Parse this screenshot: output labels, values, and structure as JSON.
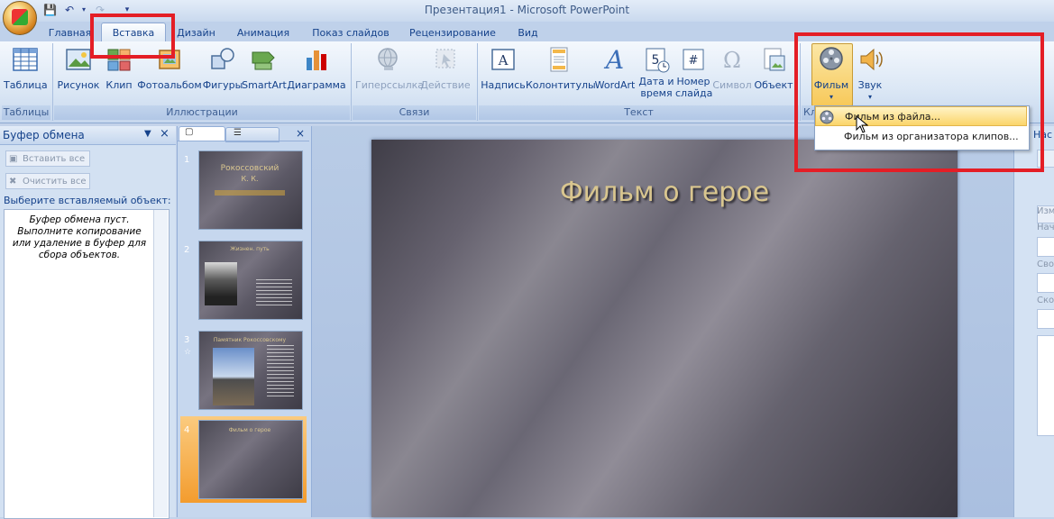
{
  "window": {
    "title": "Презентация1 - Microsoft PowerPoint"
  },
  "tabs": [
    {
      "label": "Главная"
    },
    {
      "label": "Вставка"
    },
    {
      "label": "Дизайн"
    },
    {
      "label": "Анимация"
    },
    {
      "label": "Показ слайдов"
    },
    {
      "label": "Рецензирование"
    },
    {
      "label": "Вид"
    }
  ],
  "ribbon": {
    "groups": {
      "tables": "Таблицы",
      "illustrations": "Иллюстрации",
      "links": "Связи",
      "text": "Текст",
      "media": "Кл"
    },
    "buttons": {
      "table": "Таблица",
      "picture": "Рисунок",
      "clip": "Клип",
      "photo_album": "Фотоальбом",
      "shapes": "Фигуры",
      "smartart": "SmartArt",
      "chart": "Диаграмма",
      "hyperlink": "Гиперссылка",
      "action": "Действие",
      "textbox": "Надпись",
      "header_footer": "Колонтитулы",
      "wordart": "WordArt",
      "datetime_1": "Дата и",
      "datetime_2": "время",
      "slide_number_1": "Номер",
      "slide_number_2": "слайда",
      "symbol": "Символ",
      "object": "Объект",
      "movie": "Фильм",
      "sound": "Звук"
    }
  },
  "movie_menu": {
    "from_file": "Фильм из файла...",
    "from_organizer": "Фильм из организатора клипов..."
  },
  "clipboard": {
    "title": "Буфер обмена",
    "paste_all": "Вставить все",
    "clear_all": "Очистить все",
    "choose_label": "Выберите вставляемый объект:",
    "empty_message": "Буфер обмена пуст. Выполните копирование или удаление в буфер для сбора объектов."
  },
  "slides": [
    {
      "number": "1",
      "title": "Рокоссовский",
      "subtitle": "К. К."
    },
    {
      "number": "2",
      "title": "Жизнен. путь"
    },
    {
      "number": "3",
      "title": "Памятник Рокоссовскому"
    },
    {
      "number": "4",
      "title": "Фильм о герое"
    }
  ],
  "current_slide": {
    "title": "Фильм о герое"
  },
  "right_pane": {
    "title": "Нас",
    "label1": "Изм",
    "label2": "Нач",
    "label3": "Сво",
    "label4": "Ско"
  },
  "colors": {
    "highlight": "#e41e26",
    "ribbon_text": "#15428b"
  }
}
